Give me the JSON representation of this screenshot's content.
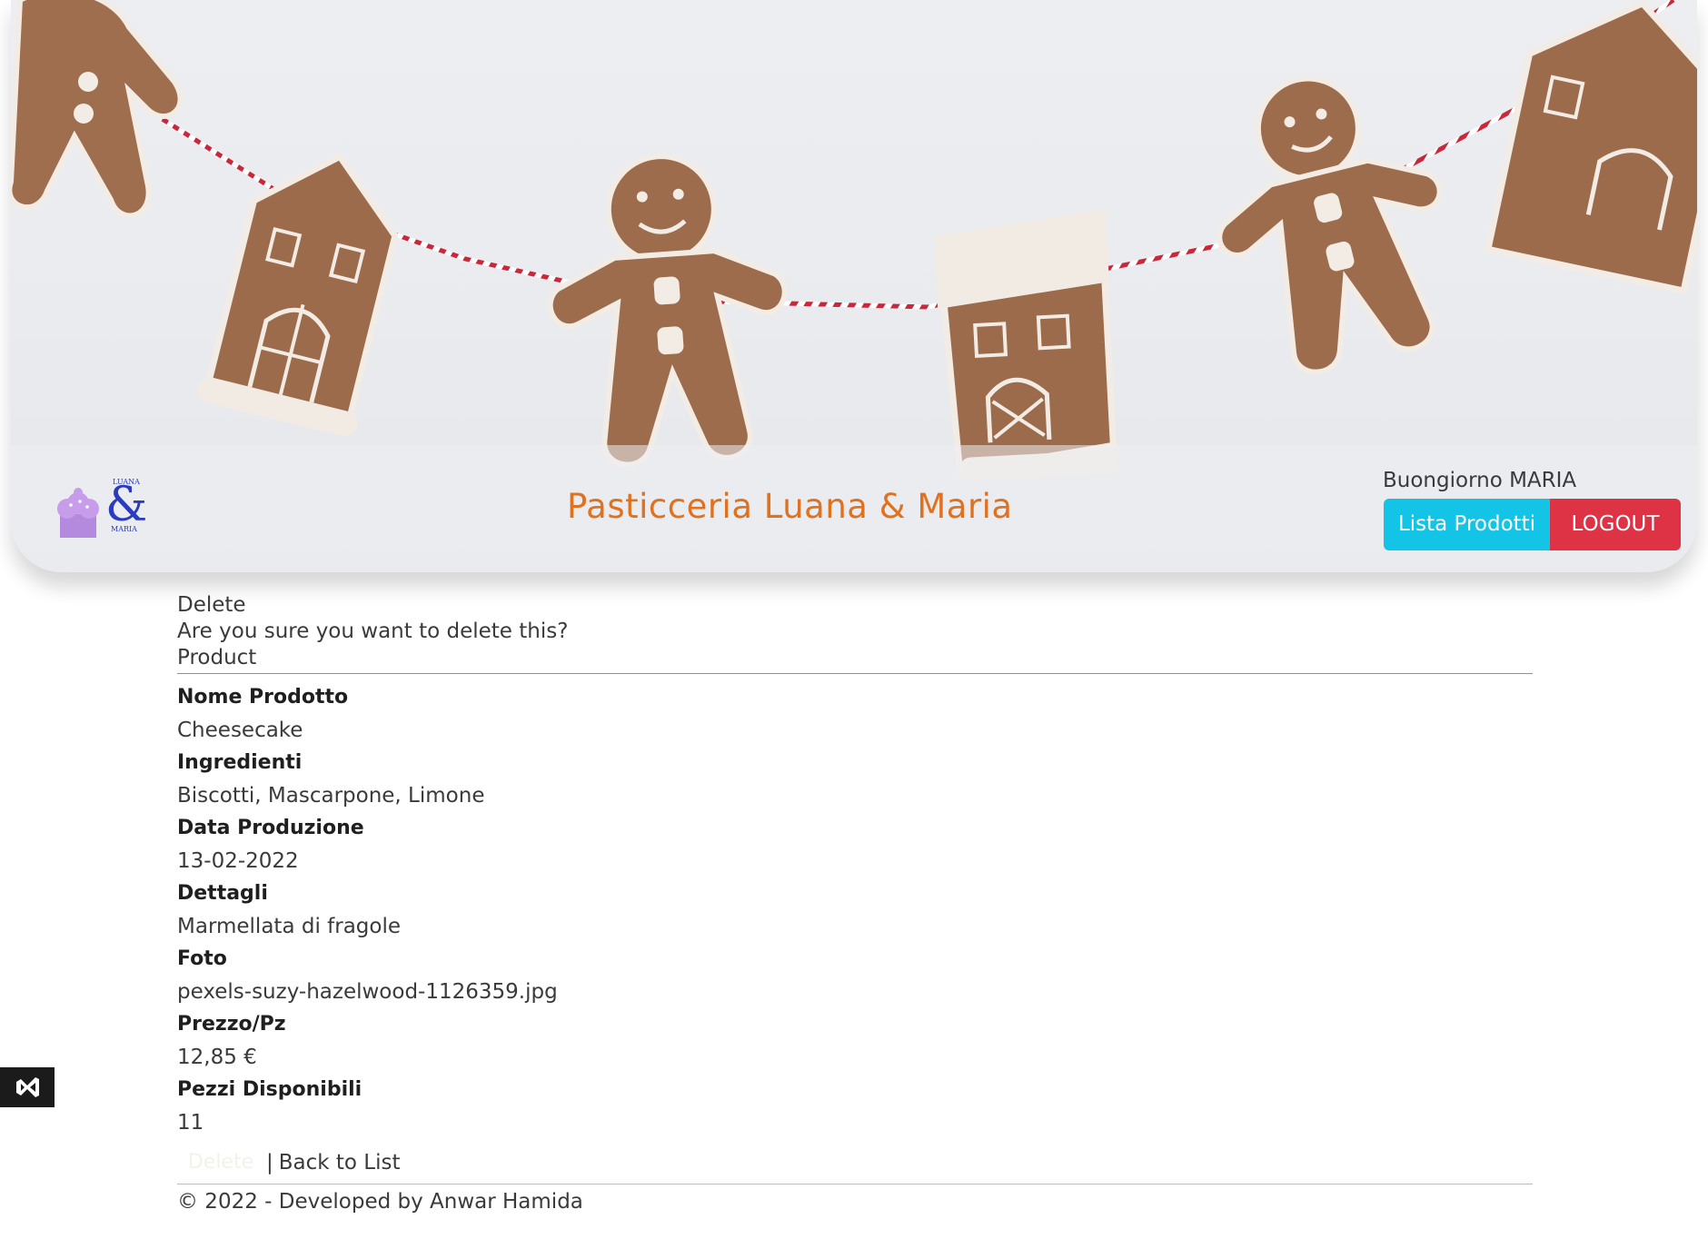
{
  "header": {
    "logo_icon": "cupcake-ampersand-logo",
    "logo_text_top": "LUANA",
    "logo_ampersand": "&",
    "logo_text_bottom": "MARIA",
    "site_title": "Pasticceria Luana & Maria",
    "greeting": "Buongiorno MARIA",
    "nav_list_label": "Lista Prodotti",
    "logout_label": "LOGOUT",
    "colors": {
      "title": "#e0711f",
      "list_button": "#13c4e6",
      "logout_button": "#de3345"
    }
  },
  "page": {
    "heading": "Delete",
    "question": "Are you sure you want to delete this?",
    "entity": "Product"
  },
  "details": [
    {
      "label": "Nome Prodotto",
      "value": "Cheesecake"
    },
    {
      "label": "Ingredienti",
      "value": "Biscotti, Mascarpone, Limone"
    },
    {
      "label": "Data Produzione",
      "value": "13-02-2022"
    },
    {
      "label": "Dettagli",
      "value": "Marmellata di fragole"
    },
    {
      "label": "Foto",
      "value": "pexels-suzy-hazelwood-1126359.jpg"
    },
    {
      "label": "Prezzo/Pz",
      "value": "12,85 €"
    },
    {
      "label": "Pezzi Disponibili",
      "value": "11"
    }
  ],
  "actions": {
    "delete_label": "Delete",
    "separator": "|",
    "back_label": "Back to List"
  },
  "footer": {
    "text": "© 2022 - Developed by Anwar Hamida"
  },
  "dev_badge": {
    "icon": "visual-studio-icon"
  }
}
